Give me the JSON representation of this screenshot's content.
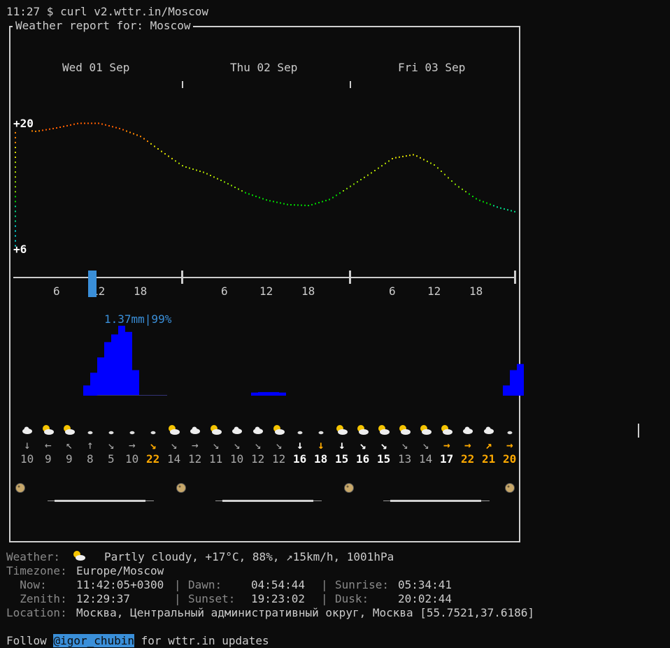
{
  "prompt": {
    "text": "11:27 $ curl v2.wttr.in/Moscow"
  },
  "report": {
    "title_prefix": "Weather report for: ",
    "city": "Moscow",
    "days": [
      "Wed 01 Sep",
      "Thu 02 Sep",
      "Fri 03 Sep"
    ]
  },
  "chart_data": [
    {
      "type": "scatter",
      "title": "",
      "ylim": [
        6,
        20
      ],
      "y_tick_labels": [
        "+20",
        "+6"
      ],
      "x_tick_labels": [
        "6",
        "12",
        "18",
        "6",
        "12",
        "18",
        "6",
        "12",
        "18"
      ],
      "x": [
        0,
        3,
        6,
        9,
        12,
        15,
        18,
        21,
        24,
        27,
        30,
        33,
        36,
        39,
        42,
        45,
        48,
        51,
        54,
        57,
        60,
        63,
        66,
        69,
        72
      ],
      "values": [
        19.5,
        19.3,
        19.7,
        20.2,
        20.2,
        19.6,
        18.7,
        17.0,
        15.4,
        14.7,
        13.6,
        12.4,
        11.6,
        11.1,
        11.0,
        11.7,
        13.2,
        14.7,
        16.3,
        16.7,
        15.5,
        13.3,
        11.7,
        10.8,
        10.2
      ]
    },
    {
      "type": "bar",
      "title": "",
      "annotation": "1.37mm|99%",
      "x": [
        10,
        11,
        12,
        13,
        14,
        15,
        16,
        17,
        34,
        35,
        36,
        37,
        38,
        70,
        71,
        72
      ],
      "values": [
        0.2,
        0.45,
        0.75,
        1.05,
        1.2,
        1.37,
        1.25,
        0.5,
        0.06,
        0.07,
        0.07,
        0.07,
        0.06,
        0.2,
        0.5,
        0.62
      ]
    }
  ],
  "hourly": {
    "wind_arrows": [
      "↓",
      "←",
      "↖",
      "↑",
      "↘",
      "→",
      "↘",
      "↘",
      "→",
      "↘",
      "↘",
      "↘",
      "↘",
      "↓",
      "↓",
      "↓",
      "↘",
      "↘",
      "↘",
      "↘",
      "→",
      "→",
      "↗",
      "→"
    ],
    "wind_speeds": [
      "10",
      "9",
      "9",
      "8",
      "5",
      "10",
      "22",
      "14",
      "12",
      "11",
      "10",
      "12",
      "12",
      "16",
      "18",
      "15",
      "16",
      "15",
      "13",
      "14",
      "17",
      "22",
      "21",
      "20"
    ],
    "icons": [
      "cloud",
      "partly-cloudy",
      "partly-cloudy",
      "small-cloud",
      "small-cloud",
      "small-cloud",
      "small-cloud",
      "partly-cloudy",
      "cloud",
      "partly-cloudy",
      "cloud",
      "cloud",
      "partly-cloudy",
      "small-cloud",
      "small-cloud",
      "partly-cloudy",
      "partly-cloudy",
      "partly-cloudy",
      "partly-cloudy",
      "partly-cloudy",
      "partly-cloudy",
      "cloud",
      "cloud",
      "small-cloud"
    ]
  },
  "colors": {
    "arrow_gray": "#aaaaaa",
    "arrow_white": "#ffffff",
    "arrow_orange": "#ffaa00",
    "precip_blue": "#0000ff",
    "annotation_blue": "#3a8fd9"
  },
  "current": {
    "weather_label": "Weather:",
    "weather_text": "Partly cloudy, +17°C, 88%, ↗15km/h, 1001hPa",
    "timezone_label": "Timezone:",
    "timezone": "Europe/Moscow",
    "now_label": "  Now:",
    "now": "11:42:05+0300",
    "dawn_label": "Dawn:",
    "dawn": "04:54:44",
    "sunrise_label": "Sunrise:",
    "sunrise": "05:34:41",
    "zenith_label": "  Zenith:",
    "zenith": "12:29:37",
    "sunset_label": "Sunset:",
    "sunset": "19:23:02",
    "dusk_label": "Dusk:",
    "dusk": "20:02:44",
    "location_label": "Location:",
    "location": "Москва, Центральный административный округ, Москва [55.7521,37.6186]"
  },
  "footer": {
    "follow": "Follow ",
    "handle": "@igor_chubin",
    "rest": " for wttr.in updates"
  }
}
